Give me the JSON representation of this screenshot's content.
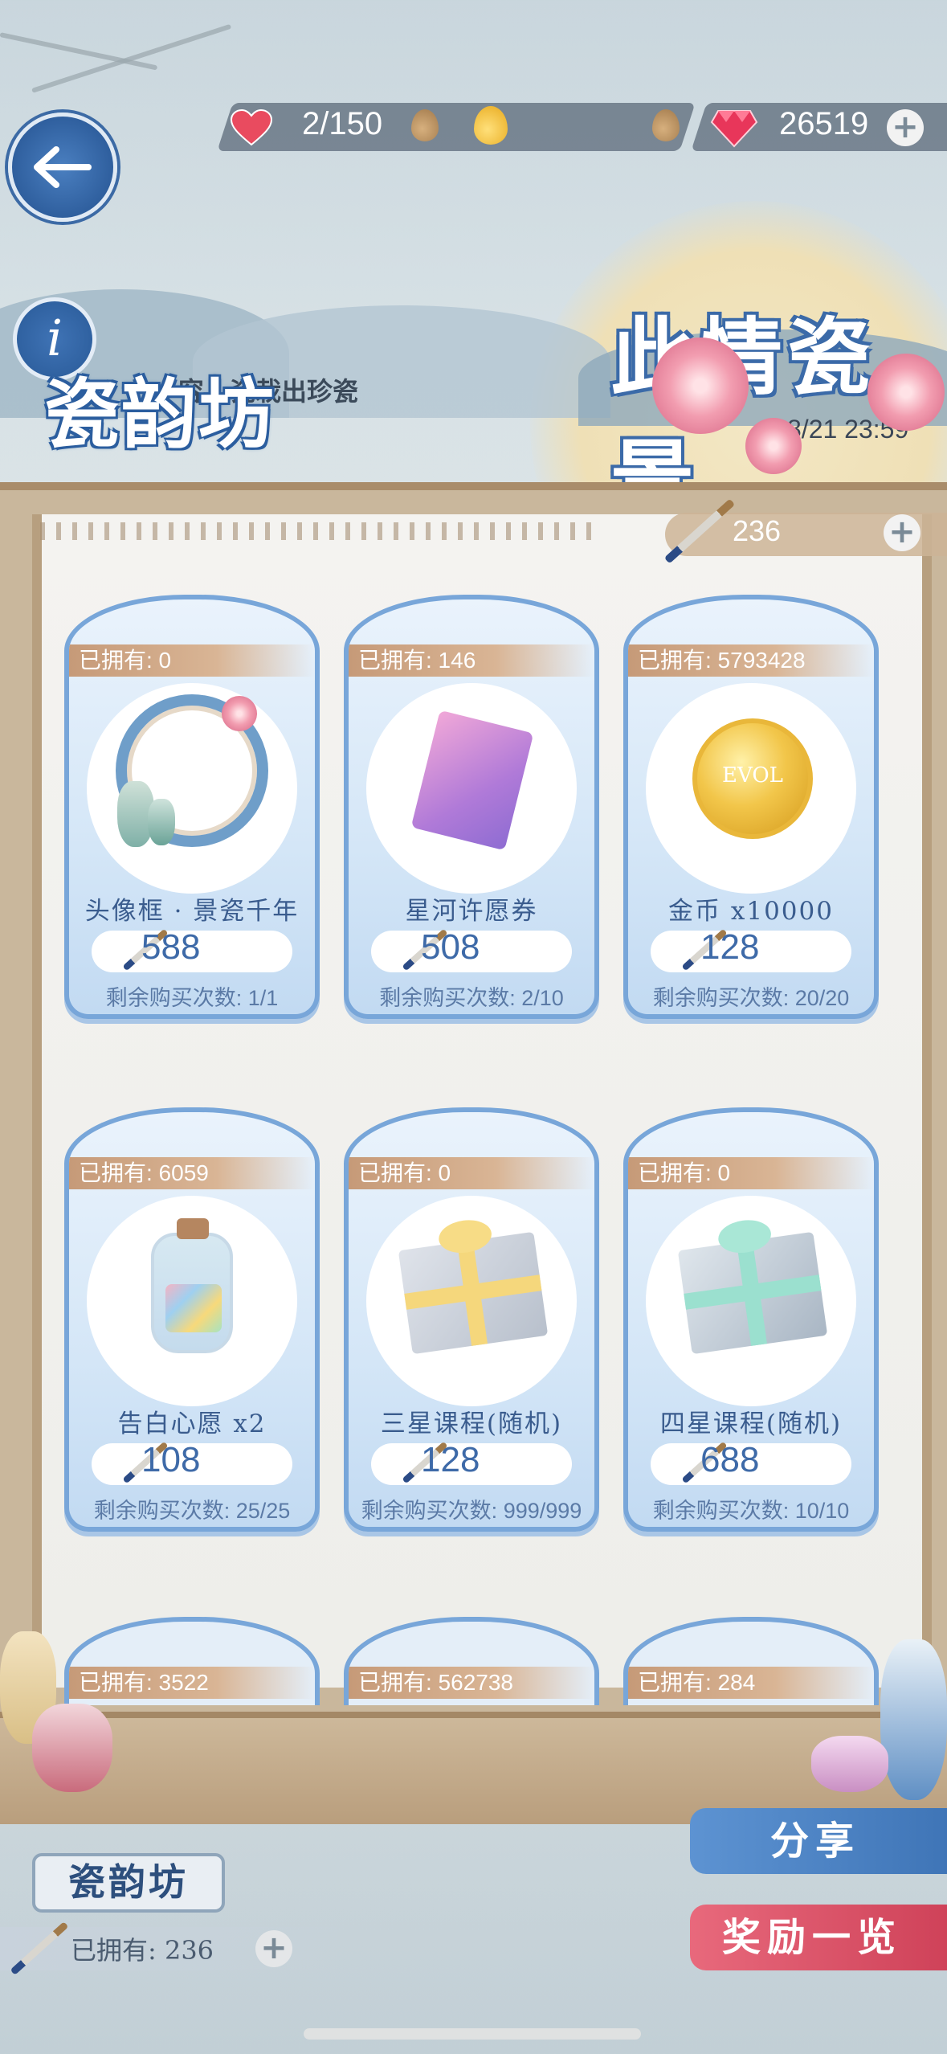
{
  "header": {
    "stamina": "2/150",
    "gems": "26519"
  },
  "titles": {
    "shop_title": "瓷韵坊",
    "shop_subtitle": "容…瓷栽出珍瓷",
    "event_title": "此情瓷景",
    "event_date": "8/21 23:59"
  },
  "currency": {
    "brush_count": "236"
  },
  "items": [
    {
      "owned": "已拥有: 0",
      "name": "头像框 · 景瓷千年",
      "price": "588",
      "remain": "剩余购买次数: 1/1",
      "icon": "avatar-frame-icon"
    },
    {
      "owned": "已拥有: 146",
      "name": "星河许愿券",
      "price": "508",
      "remain": "剩余购买次数: 2/10",
      "icon": "wish-ticket-icon"
    },
    {
      "owned": "已拥有: 5793428",
      "name": "金币 x10000",
      "price": "128",
      "remain": "剩余购买次数: 20/20",
      "icon": "gold-coin-icon",
      "coin_text": "EVOL"
    },
    {
      "owned": "已拥有: 6059",
      "name": "告白心愿 x2",
      "price": "108",
      "remain": "剩余购买次数: 25/25",
      "icon": "wish-bottle-icon"
    },
    {
      "owned": "已拥有: 0",
      "name": "三星课程(随机)",
      "price": "128",
      "remain": "剩余购买次数: 999/999",
      "icon": "gift-box-yellow-icon"
    },
    {
      "owned": "已拥有: 0",
      "name": "四星课程(随机)",
      "price": "688",
      "remain": "剩余购买次数: 10/10",
      "icon": "gift-box-green-icon"
    }
  ],
  "partial_items": [
    {
      "owned": "已拥有: 3522"
    },
    {
      "owned": "已拥有: 562738"
    },
    {
      "owned": "已拥有: 284"
    }
  ],
  "footer": {
    "share_label": "分享",
    "rewards_label": "奖励一览",
    "shop_tag": "瓷韵坊",
    "owned_label": "已拥有: 236"
  },
  "colors": {
    "accent_blue": "#3e6aa8",
    "card_border": "#78a6d9",
    "owned_tag": "#c69a78",
    "share_button": "#4d86c9",
    "rewards_button": "#d9546a"
  }
}
